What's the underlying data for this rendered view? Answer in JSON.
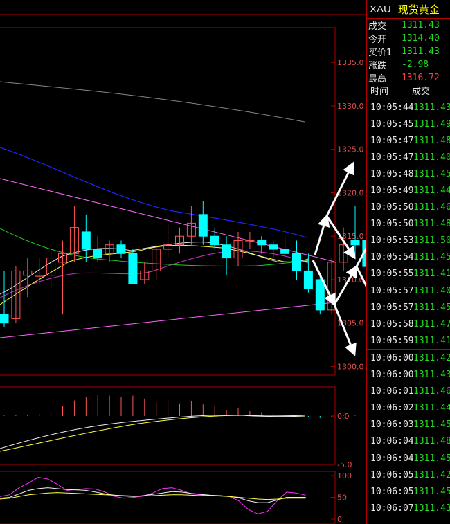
{
  "quote": {
    "symbol": "XAU",
    "name": "现货黄金",
    "rows": [
      {
        "label": "成交",
        "value": "1311.43",
        "color": "#22dd22"
      },
      {
        "label": "今开",
        "value": "1314.40",
        "color": "#22dd22"
      },
      {
        "label": "买价1",
        "value": "1311.43",
        "color": "#22dd22"
      },
      {
        "label": "涨跌",
        "value": "-2.98",
        "color": "#22dd22"
      },
      {
        "label": "最高",
        "value": "1316.72",
        "color": "#ff4444"
      }
    ]
  },
  "ticks_header": {
    "time": "时间",
    "price": "成交"
  },
  "ticks": [
    {
      "time": "10:05:44",
      "price": "1311.43"
    },
    {
      "time": "10:05:45",
      "price": "1311.49"
    },
    {
      "time": "10:05:47",
      "price": "1311.48"
    },
    {
      "time": "10:05:47",
      "price": "1311.40"
    },
    {
      "time": "10:05:48",
      "price": "1311.45"
    },
    {
      "time": "10:05:49",
      "price": "1311.44"
    },
    {
      "time": "10:05:50",
      "price": "1311.46"
    },
    {
      "time": "10:05:50",
      "price": "1311.48"
    },
    {
      "time": "10:05:53",
      "price": "1311.50"
    },
    {
      "time": "10:05:54",
      "price": "1311.45"
    },
    {
      "time": "10:05:55",
      "price": "1311.41"
    },
    {
      "time": "10:05:57",
      "price": "1311.40"
    },
    {
      "time": "10:05:57",
      "price": "1311.45"
    },
    {
      "time": "10:05:58",
      "price": "1311.47"
    },
    {
      "time": "10:05:59",
      "price": "1311.41"
    },
    {
      "time": "10:06:00",
      "price": "1311.42"
    },
    {
      "time": "10:06:00",
      "price": "1311.43"
    },
    {
      "time": "10:06:01",
      "price": "1311.46"
    },
    {
      "time": "10:06:02",
      "price": "1311.44"
    },
    {
      "time": "10:06:03",
      "price": "1311.45"
    },
    {
      "time": "10:06:04",
      "price": "1311.48"
    },
    {
      "time": "10:06:04",
      "price": "1311.45"
    },
    {
      "time": "10:06:05",
      "price": "1311.42"
    },
    {
      "time": "10:06:05",
      "price": "1311.45"
    },
    {
      "time": "10:06:07",
      "price": "1311.43"
    }
  ],
  "colors": {
    "up": "#ff5555",
    "down": "#00ffff",
    "grid": "#b00000",
    "axis_text": "#e05050"
  },
  "chart_data": [
    {
      "type": "candlestick",
      "ylim": [
        1299,
        1339
      ],
      "yticks": [
        "1300.0",
        "1305.0",
        "1310.0",
        "1315.0",
        "1320.0",
        "1325.0",
        "1330.0",
        "1335.0"
      ],
      "candles": [
        {
          "o": 1306.0,
          "h": 1311.0,
          "l": 1304.5,
          "c": 1305.0
        },
        {
          "o": 1305.5,
          "h": 1311.5,
          "l": 1305.0,
          "c": 1311.0
        },
        {
          "o": 1310.5,
          "h": 1312.5,
          "l": 1308.0,
          "c": 1311.0
        },
        {
          "o": 1310.5,
          "h": 1312.5,
          "l": 1309.5,
          "c": 1310.5
        },
        {
          "o": 1310.5,
          "h": 1313.5,
          "l": 1309.0,
          "c": 1312.5
        },
        {
          "o": 1312.0,
          "h": 1314.5,
          "l": 1306.0,
          "c": 1313.0
        },
        {
          "o": 1313.0,
          "h": 1318.5,
          "l": 1312.0,
          "c": 1316.0
        },
        {
          "o": 1315.5,
          "h": 1317.5,
          "l": 1312.0,
          "c": 1313.5
        },
        {
          "o": 1313.5,
          "h": 1315.0,
          "l": 1312.0,
          "c": 1312.5
        },
        {
          "o": 1313.0,
          "h": 1314.5,
          "l": 1312.0,
          "c": 1314.0
        },
        {
          "o": 1314.0,
          "h": 1314.5,
          "l": 1312.5,
          "c": 1313.0
        },
        {
          "o": 1313.0,
          "h": 1313.5,
          "l": 1309.5,
          "c": 1309.5
        },
        {
          "o": 1310.0,
          "h": 1312.0,
          "l": 1309.5,
          "c": 1311.0
        },
        {
          "o": 1311.0,
          "h": 1314.0,
          "l": 1310.0,
          "c": 1313.5
        },
        {
          "o": 1313.5,
          "h": 1316.5,
          "l": 1312.5,
          "c": 1314.0
        },
        {
          "o": 1314.0,
          "h": 1316.0,
          "l": 1313.0,
          "c": 1315.0
        },
        {
          "o": 1315.0,
          "h": 1318.5,
          "l": 1314.0,
          "c": 1316.5
        },
        {
          "o": 1317.5,
          "h": 1319.0,
          "l": 1314.0,
          "c": 1315.0
        },
        {
          "o": 1315.0,
          "h": 1316.0,
          "l": 1313.5,
          "c": 1314.0
        },
        {
          "o": 1314.0,
          "h": 1315.0,
          "l": 1310.5,
          "c": 1312.5
        },
        {
          "o": 1312.5,
          "h": 1315.5,
          "l": 1311.5,
          "c": 1314.5
        },
        {
          "o": 1314.5,
          "h": 1315.5,
          "l": 1313.5,
          "c": 1314.5
        },
        {
          "o": 1314.5,
          "h": 1315.0,
          "l": 1313.0,
          "c": 1314.0
        },
        {
          "o": 1314.0,
          "h": 1314.5,
          "l": 1312.5,
          "c": 1313.5
        },
        {
          "o": 1313.5,
          "h": 1315.0,
          "l": 1312.5,
          "c": 1313.0
        },
        {
          "o": 1313.0,
          "h": 1314.5,
          "l": 1310.0,
          "c": 1311.0
        },
        {
          "o": 1311.0,
          "h": 1313.0,
          "l": 1308.5,
          "c": 1309.0
        },
        {
          "o": 1310.0,
          "h": 1310.5,
          "l": 1306.0,
          "c": 1306.5
        },
        {
          "o": 1306.5,
          "h": 1312.5,
          "l": 1306.0,
          "c": 1312.0
        },
        {
          "o": 1312.0,
          "h": 1316.0,
          "l": 1311.0,
          "c": 1314.0
        },
        {
          "o": 1314.5,
          "h": 1318.5,
          "l": 1312.5,
          "c": 1314.0
        },
        {
          "o": 1314.5,
          "h": 1316.5,
          "l": 1311.0,
          "c": 1311.5
        }
      ]
    },
    {
      "type": "bar",
      "ylim": [
        -5,
        3
      ],
      "yticks": [
        "0.0",
        "-5.0"
      ],
      "values": [
        0.05,
        0.1,
        0.1,
        0.2,
        0.4,
        1.0,
        1.6,
        2.0,
        2.2,
        2.1,
        2.0,
        2.1,
        1.8,
        1.4,
        1.6,
        1.3,
        1.5,
        1.2,
        1.0,
        0.6,
        0.8,
        0.5,
        0.4,
        0.2,
        0.1,
        0.05,
        -0.1,
        -0.2,
        -0.1,
        0.1,
        0.05,
        -0.05
      ]
    },
    {
      "type": "line",
      "ylim": [
        0,
        100
      ],
      "yticks": [
        "100",
        "50",
        "0"
      ],
      "series": [
        {
          "color": "#ff33ff",
          "values": [
            52,
            56,
            72,
            83,
            96,
            92,
            80,
            66,
            68,
            70,
            69,
            62,
            52,
            48,
            50,
            53,
            60,
            70,
            72,
            66,
            58,
            56,
            53,
            54,
            52,
            42,
            22,
            12,
            18,
            42,
            62,
            60,
            55
          ]
        },
        {
          "color": "#f0f0f0",
          "values": [
            48,
            50,
            58,
            66,
            70,
            72,
            70,
            68,
            67,
            66,
            62,
            58,
            55,
            53,
            52,
            54,
            57,
            60,
            63,
            62,
            59,
            57,
            55,
            54,
            52,
            49,
            42,
            38,
            38,
            44,
            50,
            50,
            50
          ]
        },
        {
          "color": "#ffff44",
          "values": [
            46,
            48,
            52,
            56,
            58,
            60,
            61,
            60,
            59,
            58,
            57,
            56,
            55,
            54,
            53,
            53,
            54,
            55,
            56,
            56,
            55,
            54,
            54,
            53,
            52,
            50,
            48,
            46,
            45,
            46,
            48,
            48,
            48
          ]
        }
      ]
    }
  ]
}
